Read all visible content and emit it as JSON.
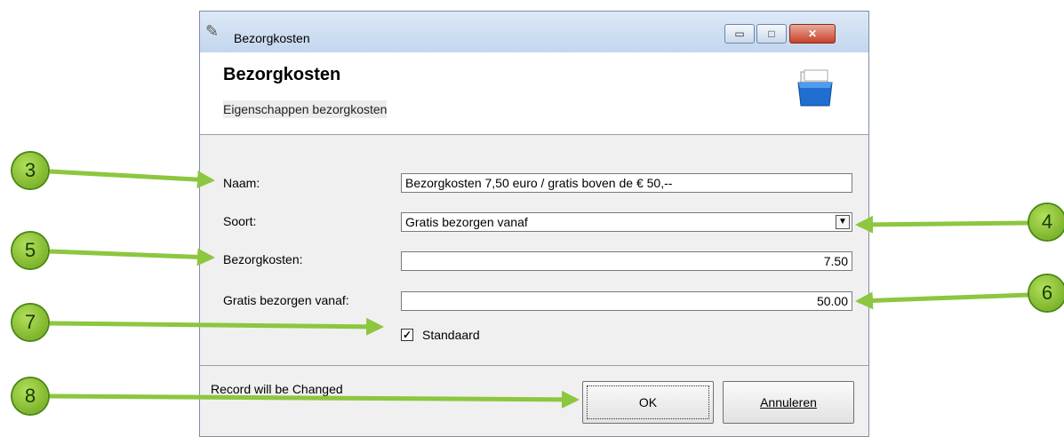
{
  "window": {
    "title": "Bezorgkosten",
    "controls": {
      "minimize": "▭",
      "maximize": "□",
      "close": "✕"
    }
  },
  "header": {
    "title": "Bezorgkosten",
    "subtitle": "Eigenschappen bezorgkosten",
    "icon": "box-icon"
  },
  "form": {
    "naam": {
      "label": "Naam:",
      "value": "Bezorgkosten 7,50 euro / gratis boven de € 50,--"
    },
    "soort": {
      "label": "Soort:",
      "value": "Gratis bezorgen vanaf",
      "arrow": "▼"
    },
    "bezorgkosten": {
      "label": "Bezorgkosten:",
      "value": "7.50"
    },
    "gratis": {
      "label": "Gratis bezorgen vanaf:",
      "value": "50.00"
    },
    "standaard": {
      "label": "Standaard",
      "checked": true,
      "mark": "✓"
    }
  },
  "footer": {
    "status": "Record will be Changed",
    "ok_label": "OK",
    "cancel_label": "Annuleren"
  },
  "annotations": [
    "3",
    "4",
    "5",
    "6",
    "7",
    "8"
  ],
  "colors": {
    "badge": "#8dc63f",
    "arrow": "#8dc63f"
  }
}
